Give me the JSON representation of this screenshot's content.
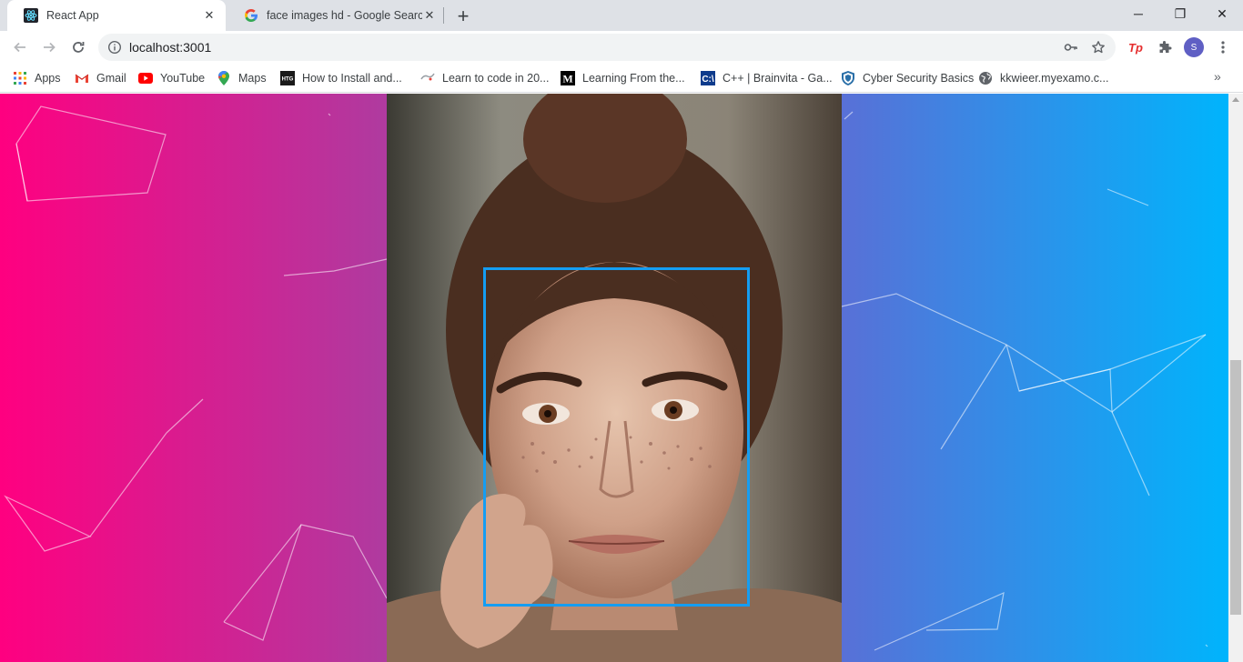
{
  "tabs": [
    {
      "title": "React App",
      "active": true,
      "favicon": "react-icon"
    },
    {
      "title": "face images hd - Google Search",
      "active": false,
      "favicon": "google-icon"
    }
  ],
  "window_controls": {
    "minimize": "─",
    "restore": "❐",
    "close": "✕"
  },
  "toolbar": {
    "url": "localhost:3001",
    "profile_initial": "S"
  },
  "bookmarks": [
    {
      "label": "Apps",
      "icon": "apps-grid-icon"
    },
    {
      "label": "Gmail",
      "icon": "gmail-icon"
    },
    {
      "label": "YouTube",
      "icon": "youtube-icon"
    },
    {
      "label": "Maps",
      "icon": "maps-icon"
    },
    {
      "label": "How to Install and...",
      "icon": "htg-icon"
    },
    {
      "label": "Learn to code in 20...",
      "icon": "learn-icon"
    },
    {
      "label": "Learning From the...",
      "icon": "medium-icon"
    },
    {
      "label": "C++ | Brainvita - Ga...",
      "icon": "cplus-icon"
    },
    {
      "label": "Cyber Security Basics",
      "icon": "shield-icon"
    },
    {
      "label": "kkwieer.myexamo.c...",
      "icon": "globe-icon"
    }
  ],
  "colors": {
    "gradient_left": "#ff0080",
    "gradient_right": "#00b4fc",
    "face_box": "#149df2"
  },
  "detection": {
    "face_box_label": "face-bounding-box"
  }
}
